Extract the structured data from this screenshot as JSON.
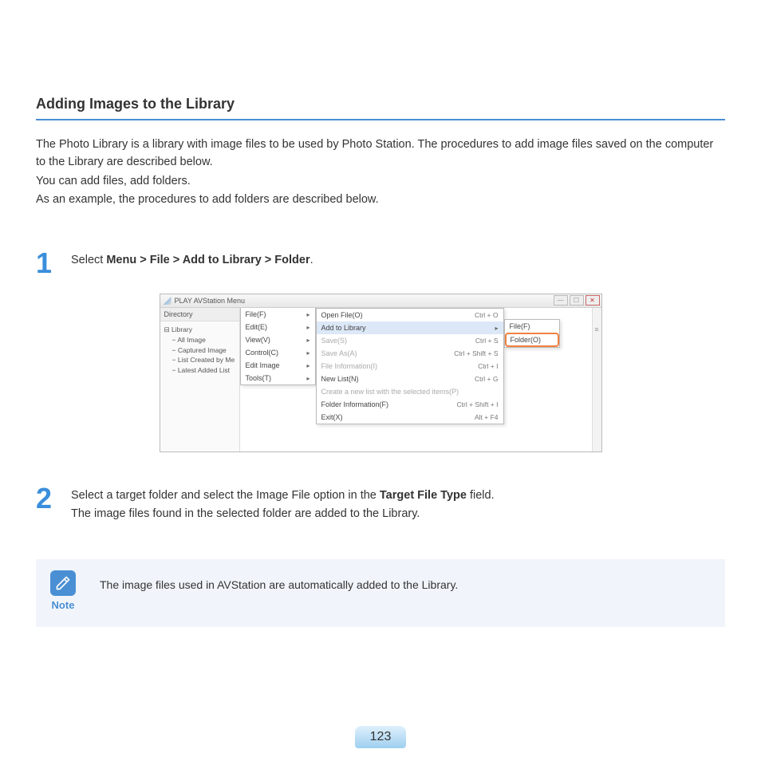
{
  "heading": "Adding Images to the Library",
  "intro": {
    "p1": "The Photo Library is a library with image files to be used by Photo Station. The procedures to add image files saved on the computer to the Library are described below.",
    "p2": "You can add files, add folders.",
    "p3": "As an example, the procedures to add folders are described below."
  },
  "step1": {
    "num": "1",
    "prefix": "Select ",
    "bold": "Menu > File > Add to Library > Folder",
    "suffix": "."
  },
  "step2": {
    "num": "2",
    "line1a": "Select a target folder and select the Image File option in the ",
    "line1b": "Target File Type",
    "line1c": " field.",
    "line2": "The image files found in the selected folder are added to the Library."
  },
  "screenshot": {
    "window_title": "PLAY AVStation  Menu",
    "sidebar_header": "Directory",
    "tree": {
      "root": "Library",
      "items": [
        "All Image",
        "Captured Image",
        "List Created by Me",
        "Latest Added List"
      ]
    },
    "menu1": [
      "File(F)",
      "Edit(E)",
      "View(V)",
      "Control(C)",
      "Edit Image",
      "Tools(T)"
    ],
    "menu2": [
      {
        "label": "Open File(O)",
        "sc": "Ctrl + O"
      },
      {
        "label": "Add to Library",
        "sc": "",
        "arrow": true,
        "hl": true
      },
      {
        "label": "Save(S)",
        "sc": "Ctrl + S",
        "disabled": true
      },
      {
        "label": "Save As(A)",
        "sc": "Ctrl + Shift + S",
        "disabled": true
      },
      {
        "label": "File Information(I)",
        "sc": "Ctrl + I",
        "disabled": true
      },
      {
        "label": "New List(N)",
        "sc": "Ctrl + G"
      },
      {
        "label": "Create a new list with the selected items(P)",
        "sc": "",
        "disabled": true
      },
      {
        "label": "Folder Information(F)",
        "sc": "Ctrl + Shift + I"
      },
      {
        "label": "Exit(X)",
        "sc": "Alt + F4"
      }
    ],
    "menu3": [
      {
        "label": "File(F)"
      },
      {
        "label": "Folder(O)",
        "hl": true
      }
    ]
  },
  "note": {
    "label": "Note",
    "text": "The image files used in AVStation are automatically added to the Library."
  },
  "page_number": "123"
}
